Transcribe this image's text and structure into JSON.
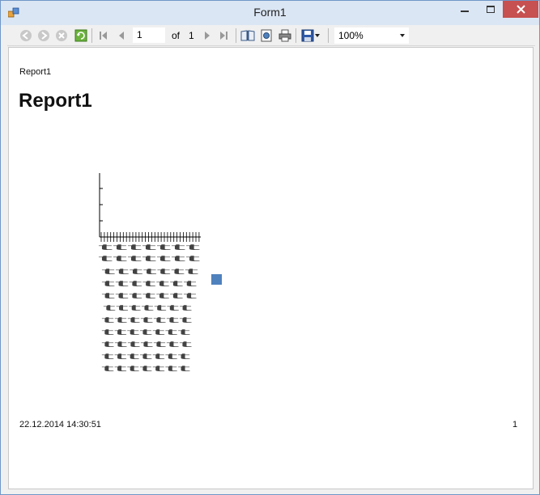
{
  "window": {
    "title": "Form1"
  },
  "toolbar": {
    "current_page": "1",
    "of_label": "of",
    "total_pages": "1",
    "zoom": "100%"
  },
  "report": {
    "name_header": "Report1",
    "title": "Report1",
    "date": "22.12.2014 14:30:51",
    "page_number": "1"
  },
  "chart_data": {
    "type": "bar",
    "categories": [],
    "values": [],
    "legend_marker_color": "#4f81bd"
  },
  "colors": {
    "legend_marker": "#4f81bd",
    "close_button": "#c75050"
  }
}
